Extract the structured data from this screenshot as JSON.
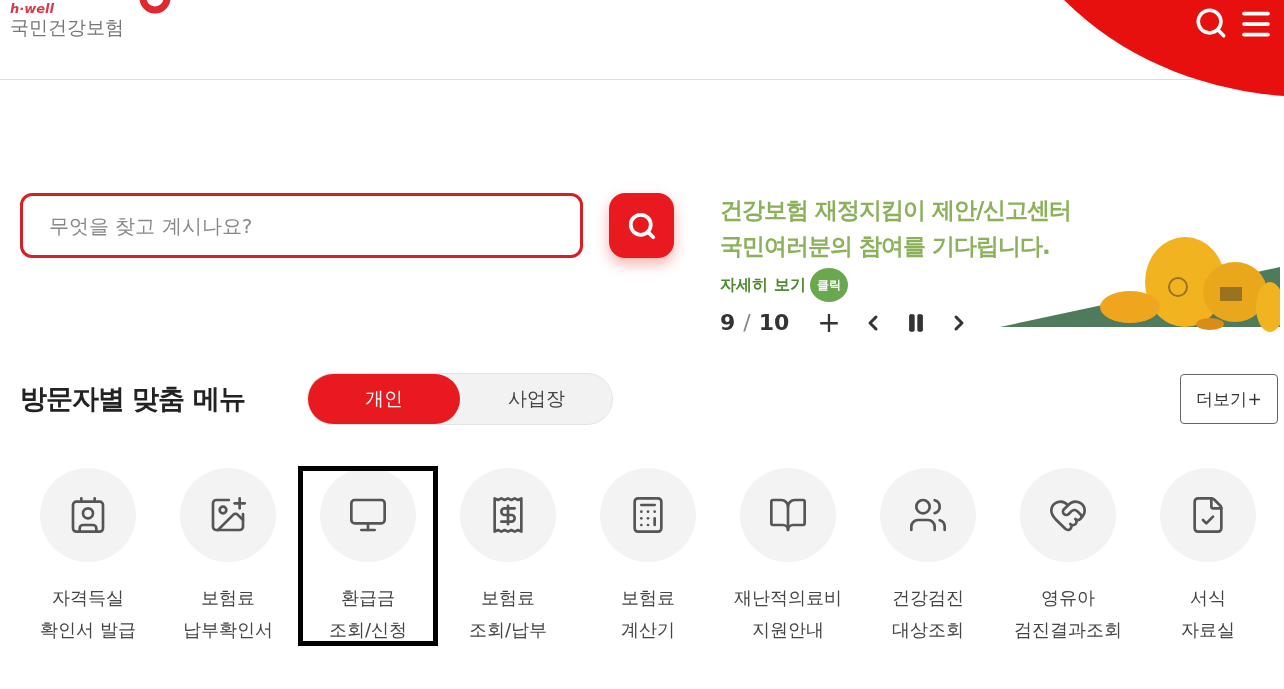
{
  "header": {
    "logo_tagline": "h·well",
    "logo_name": "국민건강보험"
  },
  "search": {
    "placeholder": "무엇을 찾고 계시나요?"
  },
  "banner": {
    "line_1": "건강보험 **재정지킴이 제안/신고센터**",
    "line_2": "**국민여러분**의 **참여를 기다립니다.**",
    "more_label": "자세히 보기",
    "click_badge": "클릭",
    "counter_current": "9",
    "counter_separator": "/",
    "counter_total": "10",
    "add": "+"
  },
  "menu": {
    "title": "방문자별 맞춤 메뉴",
    "tabs": [
      {
        "label": "개인",
        "selected": true
      },
      {
        "label": "사업장",
        "selected": false
      }
    ],
    "more": "더보기+",
    "items": [
      {
        "kind": "id-card",
        "lines": [
          "자격득실",
          "확인서 발급"
        ],
        "highlighted": false
      },
      {
        "kind": "photo-search",
        "lines": [
          "보험료",
          "납부확인서"
        ],
        "highlighted": false
      },
      {
        "kind": "monitor",
        "lines": [
          "환급금",
          "조회/신청"
        ],
        "highlighted": true
      },
      {
        "kind": "receipt",
        "lines": [
          "보험료",
          "조회/납부"
        ],
        "highlighted": false
      },
      {
        "kind": "calculator",
        "lines": [
          "보험료",
          "계산기"
        ],
        "highlighted": false
      },
      {
        "kind": "book",
        "lines": [
          "재난적의료비",
          "지원안내"
        ],
        "highlighted": false
      },
      {
        "kind": "people-search",
        "lines": [
          "건강검진",
          "대상조회"
        ],
        "highlighted": false
      },
      {
        "kind": "family",
        "lines": [
          "영유아",
          "검진결과조회"
        ],
        "highlighted": false
      },
      {
        "kind": "document",
        "lines": [
          "서식",
          "자료실"
        ],
        "highlighted": false
      }
    ]
  }
}
